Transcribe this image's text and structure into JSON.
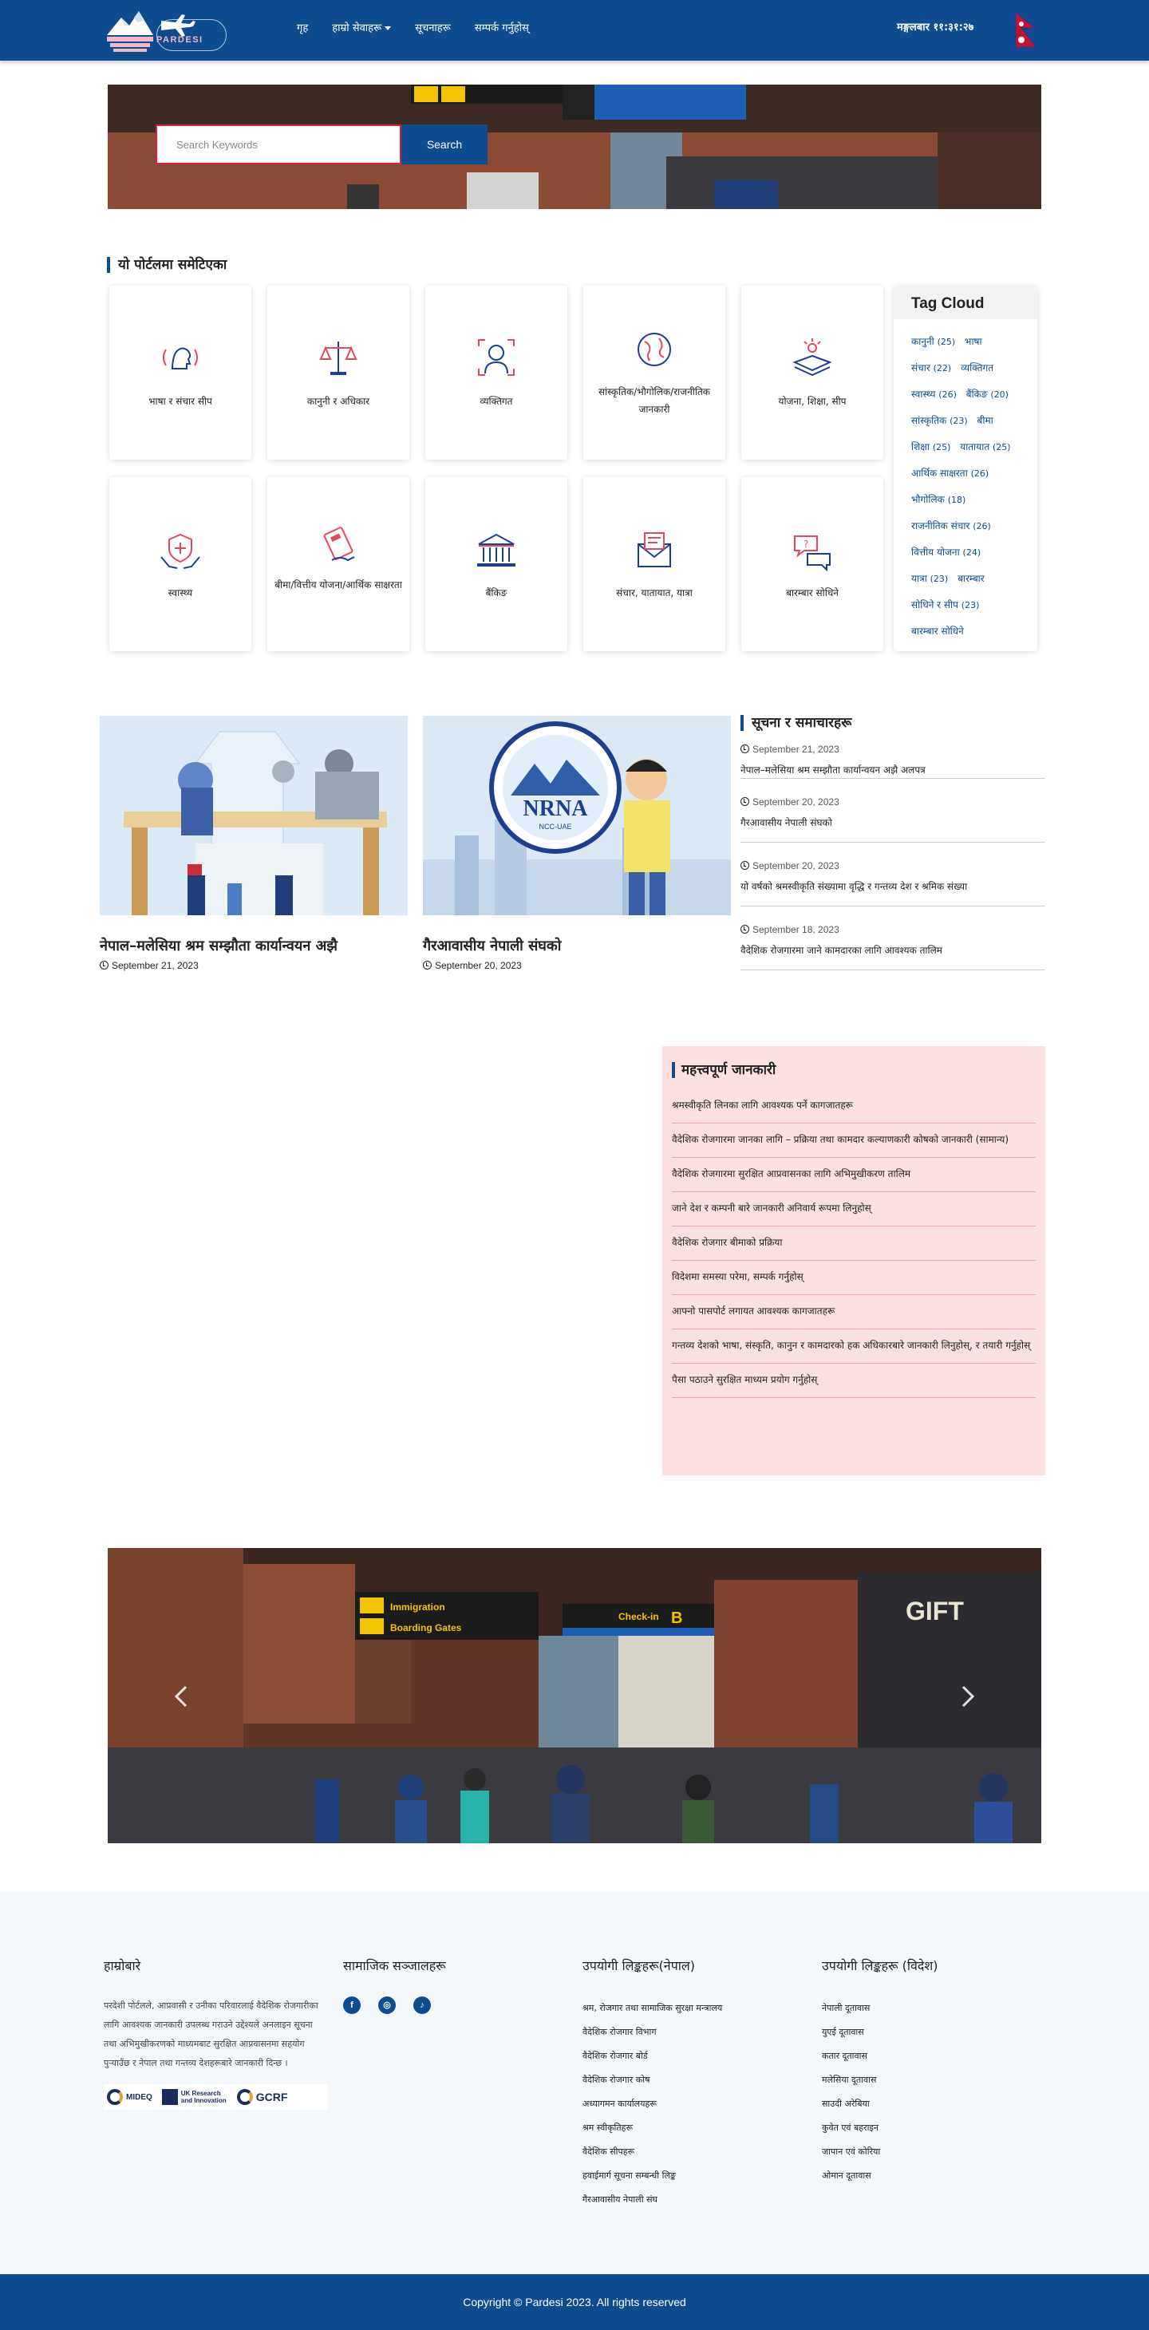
{
  "navbar": {
    "brand": "PARDESI",
    "links": [
      "गृह",
      "हाम्रो सेवाहरू",
      "सूचनाहरू",
      "सम्पर्क गर्नुहोस्"
    ],
    "clock": "मङ्गलबार ११:३१:२७"
  },
  "search": {
    "placeholder": "Search Keywords",
    "button": "Search"
  },
  "services": {
    "title": "यो पोर्टलमा समेटिएका",
    "items": [
      {
        "label": "भाषा र संचार सीप",
        "icon": "head-icon"
      },
      {
        "label": "कानुनी र अधिकार",
        "icon": "scales-icon"
      },
      {
        "label": "व्यक्तिगत",
        "icon": "person-icon"
      },
      {
        "label": "सांस्कृतिक/भौगोलिक/राजनीतिक जानकारी",
        "icon": "globe-icon"
      },
      {
        "label": "योजना, शिक्षा, सीप",
        "icon": "book-icon"
      },
      {
        "label": "स्वास्थ्य",
        "icon": "health-icon"
      },
      {
        "label": "बीमा/वित्तीय योजना/आर्थिक साक्षरता",
        "icon": "calculator-icon"
      },
      {
        "label": "बैंकिङ",
        "icon": "bank-icon"
      },
      {
        "label": "संचार, यातायात, यात्रा",
        "icon": "mail-icon"
      },
      {
        "label": "बारम्बार सोधिने",
        "icon": "chat-icon"
      }
    ]
  },
  "tag_cloud": {
    "title": "Tag Cloud",
    "tags": [
      {
        "name": "कानुनी",
        "count": "(25)"
      },
      {
        "name": "भाषा",
        "count": ""
      },
      {
        "name": "संचार",
        "count": "(22)"
      },
      {
        "name": "व्यक्तिगत",
        "count": ""
      },
      {
        "name": "स्वास्थ्य",
        "count": "(26)"
      },
      {
        "name": "बैंकिङ",
        "count": "(20)"
      },
      {
        "name": "सांस्कृतिक",
        "count": "(23)"
      },
      {
        "name": "बीमा",
        "count": ""
      },
      {
        "name": "शिक्षा",
        "count": "(25)"
      },
      {
        "name": "यातायात",
        "count": "(25)"
      },
      {
        "name": "आर्थिक साक्षरता",
        "count": "(26)"
      },
      {
        "name": "भौगोलिक",
        "count": "(18)"
      },
      {
        "name": "राजनीतिक संचार",
        "count": "(26)"
      },
      {
        "name": "वित्तीय योजना",
        "count": "(24)"
      },
      {
        "name": "यात्रा",
        "count": "(23)"
      },
      {
        "name": "बारम्बार",
        "count": ""
      },
      {
        "name": "सोधिने र सीप",
        "count": "(23)"
      },
      {
        "name": "बारम्बार सोधिने",
        "count": ""
      }
    ]
  },
  "news": {
    "cards": [
      {
        "title": "नेपाल–मलेसिया श्रम सम्झौता कार्यान्वयन अझै",
        "date": "September 21, 2023"
      },
      {
        "title": "गैरआवासीय नेपाली संघको",
        "date": "September 20, 2023"
      }
    ],
    "notices_title": "सूचना र समाचारहरू",
    "notices": [
      {
        "date": "September 21, 2023",
        "title": "नेपाल–मलेसिया श्रम सम्झौता कार्यान्वयन अझै अलपत्र"
      },
      {
        "date": "September 20, 2023",
        "title": "गैरआवासीय नेपाली संघको"
      },
      {
        "date": "September 20, 2023",
        "title": "यो वर्षको श्रमस्वीकृति संख्यामा वृद्धि र गन्तव्य देश र श्रमिक संख्या"
      },
      {
        "date": "September 18, 2023",
        "title": "वैदेशिक रोजगारमा जाने कामदारका लागि आवश्यक तालिम"
      }
    ]
  },
  "important_info": {
    "title": "महत्त्वपूर्ण जानकारी",
    "items": [
      "श्रमस्वीकृति लिनका लागि आवश्यक पर्ने कागजातहरू",
      "वैदेशिक रोजगारमा जानका लागि – प्रक्रिया तथा कामदार कल्याणकारी कोषको जानकारी (सामान्य)",
      "वैदेशिक रोजगारमा सुरक्षित आप्रवासनका लागि अभिमुखीकरण तालिम",
      "जाने देश र कम्पनी बारे जानकारी अनिवार्य रूपमा लिनुहोस्",
      "वैदेशिक रोजगार बीमाको प्रक्रिया",
      "विदेशमा समस्या परेमा, सम्पर्क गर्नुहोस्",
      "आफ्नो पासपोर्ट लगायत आवश्यक कागजातहरू",
      "गन्तव्य देशको भाषा, संस्कृति, कानुन र कामदारको हक अधिकारबारे जानकारी लिनुहोस्, र तयारी गर्नुहोस्",
      "पैसा पठाउने सुरक्षित माध्यम प्रयोग गर्नुहोस्"
    ]
  },
  "footer": {
    "about_title": "हाम्रोबारे",
    "about_text": "परदेशी पोर्टलले, आप्रवासी र उनीका परिवारलाई वैदेशिक रोजगारीका लागि आवश्यक जानकारी उपलब्ध गराउने उद्देश्यले अनलाइन सूचना तथा अभिमुखीकरणको माध्यमबाट सुरक्षित आप्रवासनमा सहयोग पुर्‍याउँछ र नेपाल तथा गन्तव्य देशहरूबारे जानकारी दिन्छ ।",
    "partners": [
      "MIDEQ",
      "UK Research and Innovation",
      "GCRF"
    ],
    "social_title": "सामाजिक सञ्जालहरू",
    "social": [
      {
        "label": "f",
        "icon": "facebook-icon"
      },
      {
        "label": "◎",
        "icon": "instagram-icon"
      },
      {
        "label": "♪",
        "icon": "tiktok-icon"
      }
    ],
    "useful_title": "उपयोगी लिङ्कहरू(नेपाल)",
    "useful_links": [
      "श्रम, रोजगार तथा सामाजिक सुरक्षा मन्त्रालय",
      "वैदेशिक रोजगार विभाग",
      "वैदेशिक रोजगार बोर्ड",
      "वैदेशिक रोजगार कोष",
      "अध्यागमन कार्यालयहरू",
      "श्रम स्वीकृतिहरू",
      "वैदेशिक सीपहरू",
      "हवाईमार्ग सूचना सम्बन्धी लिङ्क",
      "गैरआवासीय नेपाली संघ"
    ],
    "useful2_title": "उपयोगी लिङ्कहरू (विदेश)",
    "useful2_links": [
      "नेपाली दूतावास",
      "युएई दूतावास",
      "कतार दूतावास",
      "मलेसिया दूतावास",
      "साउदी अरेबिया",
      "कुवेत एवं बहराइन",
      "जापान एवं कोरिया",
      "ओमान दूतावास"
    ]
  },
  "copyright": "Copyright © Pardesi 2023. All rights reserved",
  "colors": {
    "primary": "#0d4c8f",
    "accent_red": "#d9223a",
    "info_bg": "#fde1e1"
  }
}
